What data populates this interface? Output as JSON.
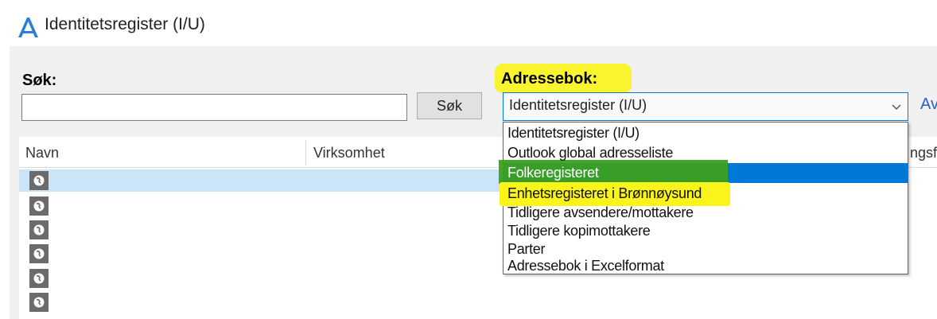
{
  "window": {
    "title": "Identitetsregister (I/U)"
  },
  "search": {
    "label": "Søk:",
    "value": "",
    "button_label": "Søk"
  },
  "addressbook": {
    "label": "Adressebok:",
    "selected": "Identitetsregister (I/U)",
    "side_link": "Av",
    "options": [
      "Identitetsregister (I/U)",
      "Outlook global adresseliste",
      "Folkeregisteret",
      "Enhetsregisteret i Brønnøysund",
      "Tidligere avsendere/mottakere",
      "Tidligere kopimottakere",
      "Parter",
      "Adressebok i Excelformat"
    ]
  },
  "list": {
    "columns": [
      "Navn",
      "Virksomhet",
      "ngsf"
    ],
    "row_count": 6
  },
  "colors": {
    "accent": "#0078d7",
    "highlight_yellow": "#fbf41a",
    "highlight_green": "#3ba01d",
    "selection": "#cce4f7"
  }
}
